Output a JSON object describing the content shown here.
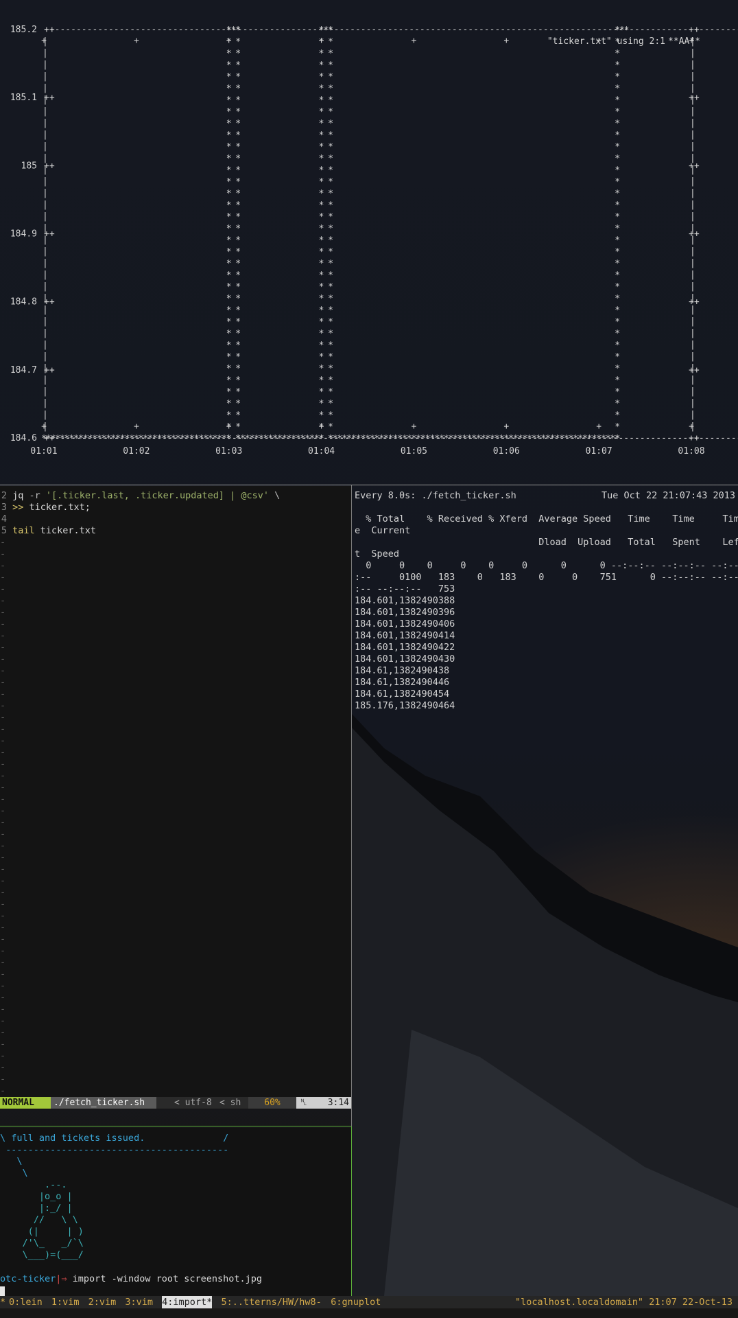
{
  "gnuplot": {
    "legend_text": "\"ticker.txt\" using 2:1",
    "legend_marker": "**AA**",
    "chart_data": {
      "type": "line",
      "title": "",
      "series": [
        {
          "values": [
            [
              1.0,
              184.6
            ],
            [
              3.0,
              184.6
            ],
            [
              3.0,
              185.2
            ],
            [
              3.1,
              185.2
            ],
            [
              3.1,
              184.6
            ],
            [
              4.0,
              184.6
            ],
            [
              4.0,
              185.2
            ],
            [
              4.1,
              185.2
            ],
            [
              4.1,
              184.6
            ],
            [
              7.2,
              184.6
            ],
            [
              7.2,
              185.2
            ],
            [
              7.3,
              185.2
            ]
          ]
        }
      ],
      "ylim": [
        184.6,
        185.2
      ],
      "yticks": [
        "185.2",
        "185.1",
        "185",
        "184.9",
        "184.8",
        "184.7",
        "184.6"
      ],
      "xticks": [
        "01:01",
        "01:02",
        "01:03",
        "01:04",
        "01:05",
        "01:06",
        "01:07",
        "01:08"
      ],
      "grid": false
    }
  },
  "vim": {
    "lines": [
      {
        "num": "2",
        "parts": [
          {
            "t": "jq",
            "c": "c-white"
          },
          {
            "t": " -r ",
            "c": "c-gray"
          },
          {
            "t": "'[.ticker.last, .ticker.updated] | @csv'",
            "c": "c-green"
          },
          {
            "t": " \\",
            "c": "c-gray"
          }
        ]
      },
      {
        "num": "3",
        "parts": [
          {
            "t": ">>",
            "c": "c-yellow"
          },
          {
            "t": " ticker.txt;",
            "c": "c-white"
          }
        ]
      },
      {
        "num": "4",
        "parts": []
      },
      {
        "num": "5",
        "parts": [
          {
            "t": "tail",
            "c": "c-yellow"
          },
          {
            "t": " ticker.txt",
            "c": "c-white"
          }
        ]
      }
    ],
    "tilde": "-",
    "status": {
      "mode": "NORMAL",
      "file": "./fetch_ticker.sh",
      "encoding": "utf-8",
      "filetype": "sh",
      "percent": "60%",
      "ln_icon": "ln-icon",
      "position": "3:14"
    }
  },
  "watch": {
    "header": "Every 8.0s: ./fetch_ticker.sh",
    "timestamp": "Tue Oct 22 21:07:43 2013",
    "lines": [
      "",
      "  % Total    % Received % Xferd  Average Speed   Time    Time     Tim",
      "e  Current",
      "                                 Dload  Upload   Total   Spent    Lef",
      "t  Speed",
      "  0     0    0     0    0     0      0      0 --:--:-- --:--:-- --:--",
      ":--     0100   183    0   183    0     0    751      0 --:--:-- --:--",
      ":-- --:--:--   753",
      "184.601,1382490388",
      "184.601,1382490396",
      "184.601,1382490406",
      "184.601,1382490414",
      "184.601,1382490422",
      "184.601,1382490430",
      "184.61,1382490438",
      "184.61,1382490446",
      "184.61,1382490454",
      "185.176,1382490464"
    ]
  },
  "cowsay": {
    "bubble_line": "\\ full and tickets issued.              /",
    "bubble_bottom": " ----------------------------------------",
    "art": [
      "   \\",
      "    \\",
      "        .--.",
      "       |o_o |",
      "       |:_/ |",
      "      //   \\ \\",
      "     (|     | )",
      "    /'\\_   _/`\\",
      "    \\___)=(___/"
    ],
    "prompt_dir": "otc-ticker",
    "prompt_sep": "|⇒",
    "command": " import -window root screenshot.jpg"
  },
  "tmux": {
    "windows": [
      {
        "label": "0:lein",
        "active": false
      },
      {
        "label": "1:vim",
        "active": false
      },
      {
        "label": "2:vim",
        "active": false
      },
      {
        "label": "3:vim",
        "active": false
      },
      {
        "label": "4:import*",
        "active": true
      },
      {
        "label": "5:..tterns/HW/hw8-",
        "active": false
      },
      {
        "label": "6:gnuplot",
        "active": false
      }
    ],
    "prefix": "*",
    "status_right": "\"localhost.localdomain\" 21:07 22-Oct-13"
  }
}
